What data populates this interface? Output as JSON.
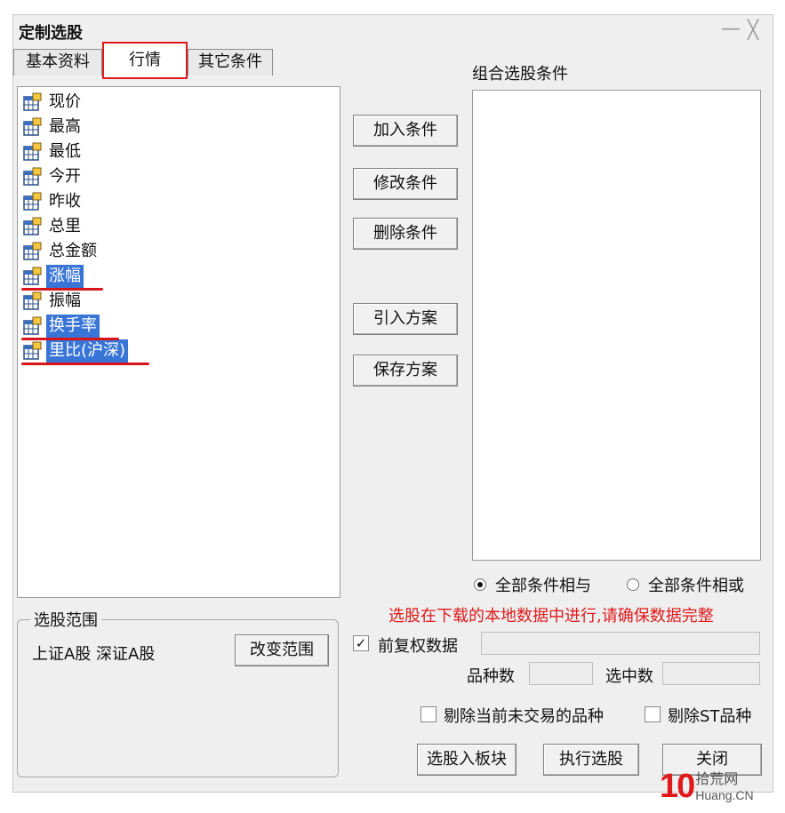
{
  "window": {
    "title": "定制选股",
    "minimize_glyph": "—",
    "close_glyph": "╳"
  },
  "tabs": [
    {
      "label": "基本资料",
      "active": false
    },
    {
      "label": "行情",
      "active": true
    },
    {
      "label": "其它条件",
      "active": false
    }
  ],
  "indicator_list": {
    "icon": "table-icon",
    "items": [
      {
        "label": "现价",
        "selected": false
      },
      {
        "label": "最高",
        "selected": false
      },
      {
        "label": "最低",
        "selected": false
      },
      {
        "label": "今开",
        "selected": false
      },
      {
        "label": "昨收",
        "selected": false
      },
      {
        "label": "总里",
        "selected": false
      },
      {
        "label": "总金额",
        "selected": false
      },
      {
        "label": "涨幅",
        "selected": true
      },
      {
        "label": "振幅",
        "selected": false
      },
      {
        "label": "换手率",
        "selected": true
      },
      {
        "label": "里比(沪深)",
        "selected": true
      }
    ]
  },
  "actions": {
    "add": "加入条件",
    "modify": "修改条件",
    "delete": "删除条件",
    "import": "引入方案",
    "save": "保存方案"
  },
  "conditions": {
    "label": "组合选股条件"
  },
  "logic": {
    "and_label": "全部条件相与",
    "or_label": "全部条件相或",
    "selected": "and"
  },
  "warning": {
    "text": "选股在下载的本地数据中进行,请确保数据完整",
    "color": "#e0191b"
  },
  "adjusted": {
    "label": "前复权数据",
    "checked": true,
    "value": ""
  },
  "counts": {
    "variety_label": "品种数",
    "variety_value": "",
    "selected_label": "选中数",
    "selected_value": ""
  },
  "filters": {
    "exclude_untraded_label": "剔除当前未交易的品种",
    "exclude_untraded_checked": false,
    "exclude_st_label": "剔除ST品种",
    "exclude_st_checked": false
  },
  "range": {
    "legend": "选股范围",
    "value": "上证A股 深证A股",
    "change_button": "改变范围"
  },
  "footer": {
    "to_block": "选股入板块",
    "execute": "执行选股",
    "close": "关闭"
  },
  "watermark": {
    "number": "10",
    "text": "拾荒网",
    "sub": "Huang.CN"
  },
  "colors": {
    "highlight": "#3875d7",
    "annotation_red": "#d8161a"
  }
}
